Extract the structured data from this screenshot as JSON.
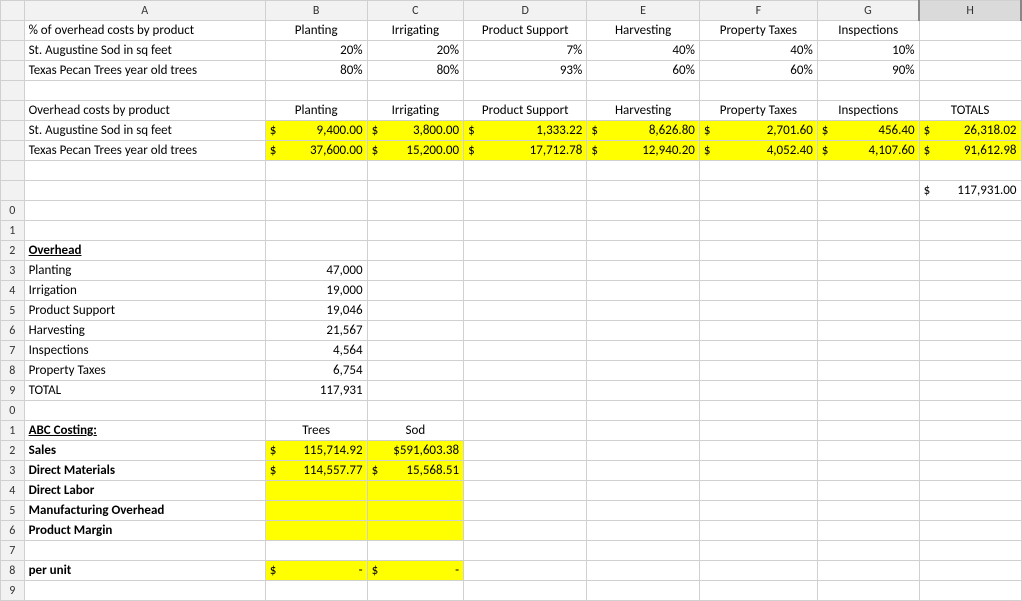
{
  "columns": [
    "A",
    "B",
    "C",
    "D",
    "E",
    "F",
    "G",
    "H"
  ],
  "rownums": [
    "",
    "",
    "",
    "",
    "",
    "",
    "",
    "",
    "",
    "0",
    "1",
    "2",
    "3",
    "4",
    "5",
    "6",
    "7",
    "8",
    "9",
    "0",
    "1",
    "2",
    "3",
    "4",
    "5",
    "6",
    "7",
    "8",
    "9"
  ],
  "r1": {
    "A": "% of overhead costs by product",
    "B": "Planting",
    "C": "Irrigating",
    "D": "Product Support",
    "E": "Harvesting",
    "F": "Property Taxes",
    "G": "Inspections"
  },
  "r2": {
    "A": "St. Augustine Sod in sq feet",
    "B": "20%",
    "C": "20%",
    "D": "7%",
    "E": "40%",
    "F": "40%",
    "G": "10%"
  },
  "r3": {
    "A": "Texas Pecan Trees year old trees",
    "B": "80%",
    "C": "80%",
    "D": "93%",
    "E": "60%",
    "F": "60%",
    "G": "90%"
  },
  "r5": {
    "A": "Overhead costs by product",
    "B": "Planting",
    "C": "Irrigating",
    "D": "Product Support",
    "E": "Harvesting",
    "F": "Property Taxes",
    "G": "Inspections",
    "H": "TOTALS"
  },
  "r6": {
    "A": "St. Augustine Sod in sq feet",
    "B": "9,400.00",
    "C": "3,800.00",
    "D": "1,333.22",
    "E": "8,626.80",
    "F": "2,701.60",
    "G": "456.40",
    "H": "26,318.02"
  },
  "r7": {
    "A": "Texas Pecan Trees year old trees",
    "B": "37,600.00",
    "C": "15,200.00",
    "D": "17,712.78",
    "E": "12,940.20",
    "F": "4,052.40",
    "G": "4,107.60",
    "H": "91,612.98"
  },
  "r9": {
    "H": "117,931.00"
  },
  "r12": {
    "A": "Overhead"
  },
  "r13": {
    "A": "Planting",
    "B": "47,000"
  },
  "r14": {
    "A": "Irrigation",
    "B": "19,000"
  },
  "r15": {
    "A": "Product Support",
    "B": "19,046"
  },
  "r16": {
    "A": "Harvesting",
    "B": "21,567"
  },
  "r17": {
    "A": "Inspections",
    "B": "4,564"
  },
  "r18": {
    "A": "Property Taxes",
    "B": "6,754"
  },
  "r19": {
    "A": "TOTAL",
    "B": "117,931"
  },
  "r21": {
    "A": "ABC Costing:",
    "B": "Trees",
    "C": "Sod"
  },
  "r22": {
    "A": "Sales",
    "B": "115,714.92",
    "C": "$591,603.38"
  },
  "r23": {
    "A": "Direct Materials",
    "B": "114,557.77",
    "C": "15,568.51"
  },
  "r24": {
    "A": "Direct Labor"
  },
  "r25": {
    "A": "Manufacturing Overhead"
  },
  "r26": {
    "A": "Product Margin"
  },
  "r28": {
    "A": "per unit",
    "Bd": "-",
    "Cd": "-"
  }
}
